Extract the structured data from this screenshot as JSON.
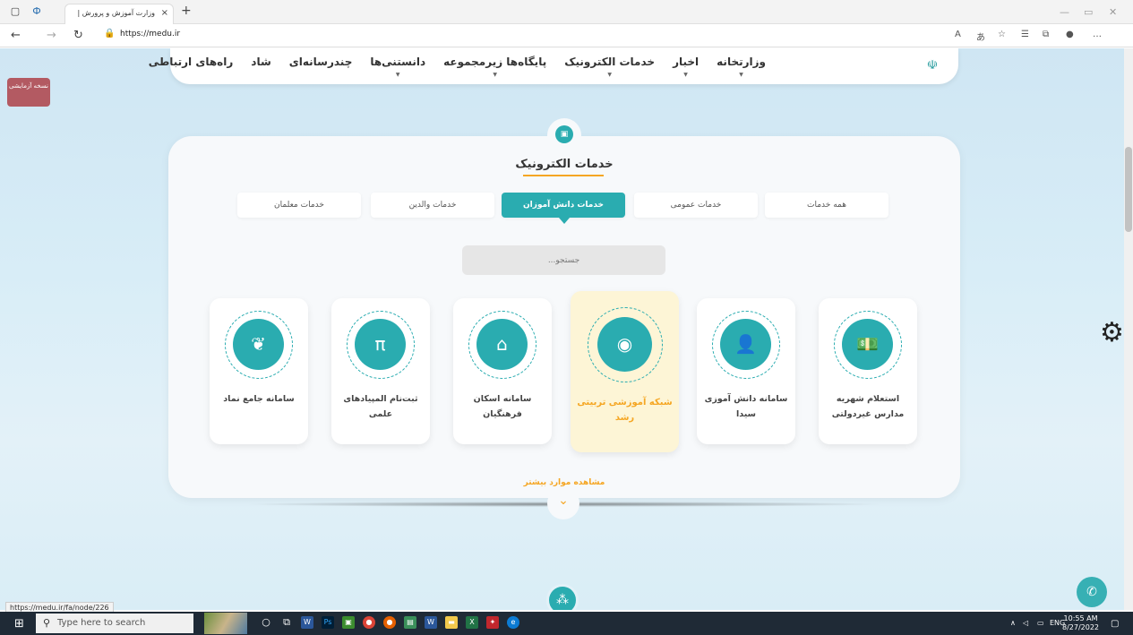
{
  "browser": {
    "tab_title": "وزارت آموزش و پرورش |",
    "tab_close": "×",
    "new_tab": "+",
    "url": "https://medu.ir",
    "status_url": "https://medu.ir/fa/node/226"
  },
  "site": {
    "nav": [
      {
        "label": "وزارتخانه",
        "caret": true
      },
      {
        "label": "اخبار",
        "caret": true
      },
      {
        "label": "خدمات الکترونیک",
        "caret": true
      },
      {
        "label": "پایگاه‌ها زیرمجموعه",
        "caret": true
      },
      {
        "label": "دانستنی‌ها",
        "caret": true
      },
      {
        "label": "چندرسانه‌ای",
        "caret": false
      },
      {
        "label": "شاد",
        "caret": false
      },
      {
        "label": "راه‌های ارتباطی",
        "caret": false
      }
    ],
    "test_badge": "نسخه آزمایشی"
  },
  "services": {
    "title": "خدمات الکترونیک",
    "tabs": [
      "همه خدمات",
      "خدمات عمومی",
      "خدمات دانش آموزان",
      "خدمات والدین",
      "خدمات معلمان"
    ],
    "active_tab": "خدمات دانش آموزان",
    "search_placeholder": "جستجو...",
    "cards": [
      {
        "label": "استعلام شهریه مدارس غیردولتی",
        "icon": "money-icon",
        "glyph": "💵"
      },
      {
        "label": "سامانه دانش آموزی سیدا",
        "icon": "student-icon",
        "glyph": "👤"
      },
      {
        "label": "شبکه آموزشی تربیتی رشد",
        "icon": "roshd-icon",
        "glyph": "◉"
      },
      {
        "label": "سامانه اسکان فرهنگیان",
        "icon": "house-icon",
        "glyph": "⌂"
      },
      {
        "label": "ثبت‌نام المپیادهای علمی",
        "icon": "science-icon",
        "glyph": "π"
      },
      {
        "label": "سامانه جامع نماد",
        "icon": "leaf-head-icon",
        "glyph": "❦"
      }
    ],
    "featured_card": "شبکه آموزشی تربیتی رشد",
    "more": "مشاهده موارد بیشتر"
  },
  "taskbar": {
    "search": "Type here to search",
    "lang": "ENG",
    "time": "10:55 AM",
    "date": "8/27/2022"
  },
  "colors": {
    "accent": "#2aacb0",
    "highlight": "#f5a623",
    "featured_bg": "#fdf5d6"
  }
}
